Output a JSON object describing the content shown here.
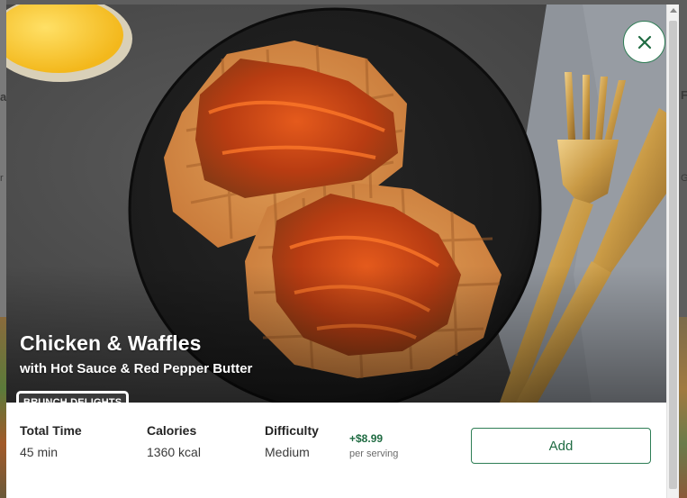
{
  "modal": {
    "title": "Chicken & Waffles",
    "subtitle": "with Hot Sauce & Red Pepper Butter",
    "tag": "BRUNCH DELIGHTS",
    "close_icon": "close-icon",
    "stats": [
      {
        "label": "Total Time",
        "value": "45 min"
      },
      {
        "label": "Calories",
        "value": "1360 kcal"
      },
      {
        "label": "Difficulty",
        "value": "Medium"
      }
    ],
    "price": {
      "amount": "+$8.99",
      "unit": "per serving"
    },
    "add_label": "Add"
  },
  "background": {
    "letters": [
      "a",
      "F",
      "r",
      "G"
    ]
  },
  "colors": {
    "accent": "#2e7d55",
    "accent_text": "#1f6b42",
    "tag_bg": "#3a3a3a"
  }
}
